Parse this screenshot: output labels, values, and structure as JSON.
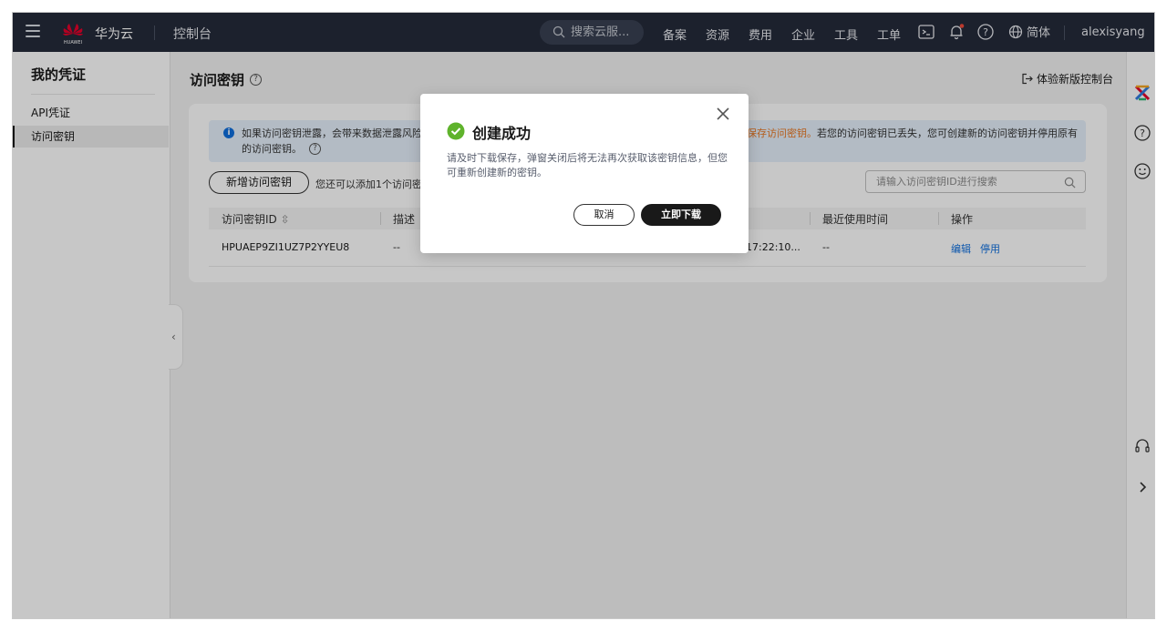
{
  "topbar": {
    "brand": "华为云",
    "logo_text": "HUAWEI",
    "console": "控制台",
    "search_placeholder": "搜索云服...",
    "nav": [
      "备案",
      "资源",
      "费用",
      "企业",
      "工具",
      "工单"
    ],
    "lang": "简体",
    "user": "alexisyang"
  },
  "sidebar": {
    "title": "我的凭证",
    "items": [
      {
        "label": "API凭证"
      },
      {
        "label": "访问密钥"
      }
    ]
  },
  "page": {
    "title": "访问密钥",
    "new_console": "体验新版控制台"
  },
  "notice": {
    "line1_a": "如果访问密钥泄露，会带来数据泄露风险",
    "line1_orange": "保存访问密钥。",
    "line1_b": "若您的访问密钥已丢失，您可创建新的访问密钥并停用原有",
    "line2": "的访问密钥。"
  },
  "toolbar": {
    "add_button": "新增访问密钥",
    "quota_text": "您还可以添加1个访问密",
    "search_placeholder": "请输入访问密钥ID进行搜索"
  },
  "table": {
    "columns": [
      "访问密钥ID",
      "描述",
      "最近使用时间",
      "操作"
    ],
    "rows": [
      {
        "id": "HPUAEP9ZI1UZ7P2YYEU8",
        "desc": "--",
        "created": "17:22:10...",
        "last_used": "--",
        "actions": [
          "编辑",
          "停用"
        ]
      }
    ]
  },
  "modal": {
    "title": "创建成功",
    "body": "请及时下载保存，弹窗关闭后将无法再次获取该密钥信息，但您可重新创建新的密钥。",
    "cancel": "取消",
    "confirm": "立即下载"
  },
  "colors": {
    "topbar": "#252b3a",
    "accent_link": "#0f6fde",
    "success": "#5fb32c",
    "warning_text": "#e87722"
  }
}
